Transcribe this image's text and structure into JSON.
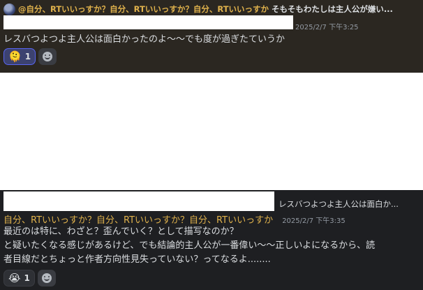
{
  "message1": {
    "reply": {
      "author": "@自分、RTいいっすか？自分、RTいいっすか？自分、RTいいっすか",
      "text": "そもそもわたしは主人公が嫌い..."
    },
    "timestamp": "2025/2/7 下午3:25",
    "body": "レスバつよつよ主人公は面白かったのよ～～でも度が過ぎたていうか",
    "reaction": {
      "emoji": "🫠",
      "count": "1"
    }
  },
  "message2": {
    "reply": {
      "text": "レスバつよつよ主人公は面白か..."
    },
    "author": "自分、RTいいっすか？自分、RTいいっすか？自分、RTいいっすか",
    "timestamp": "2025/2/7 下午3:35",
    "body_lines": [
      "最近のは特に、わざと？歪んでいく？として描写なのか？",
      "と疑いたくなる感じがあるけど、でも結論的主人公が一番偉い～～正しいよになるから、読",
      "者目線だとちょっと作者方向性見失っていない？ってなるよ........"
    ],
    "reaction": {
      "emoji": "😭",
      "count": "1"
    }
  }
}
